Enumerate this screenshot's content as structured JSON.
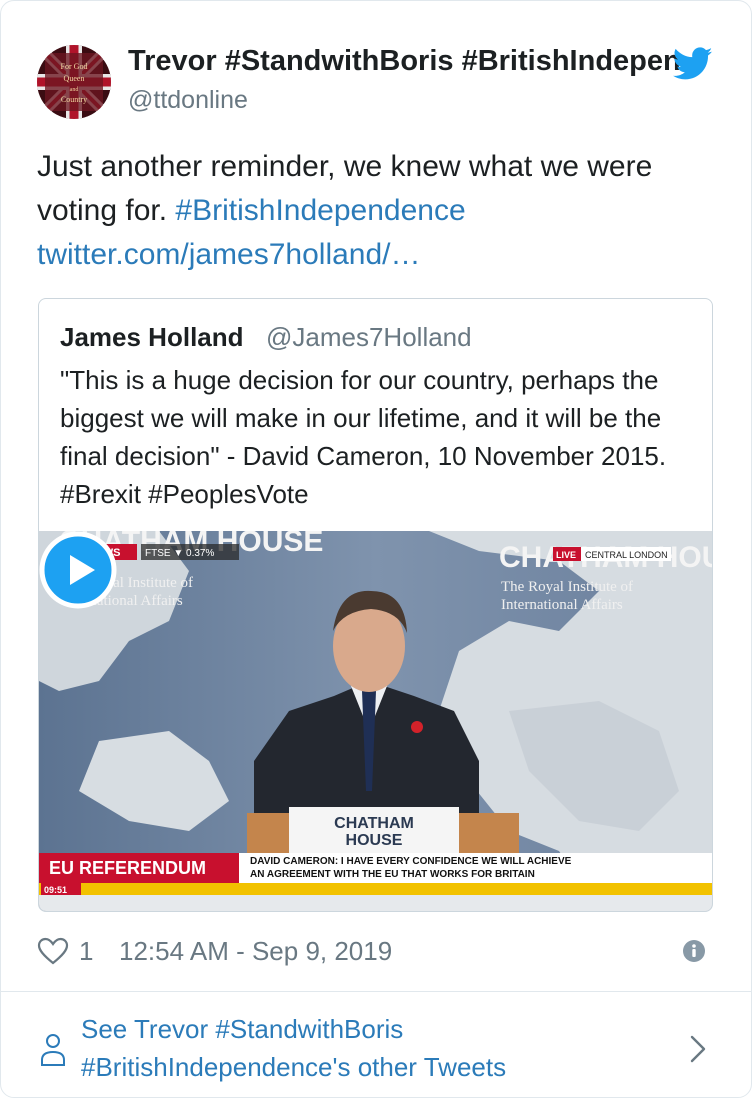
{
  "tweet": {
    "author_name": "Trevor #StandwithBoris #BritishIndependence",
    "author_handle": "@ttdonline",
    "text_plain": "Just another reminder, we knew what we were voting for. ",
    "hashtag": "#BritishIndependence",
    "link": "twitter.com/james7holland/…",
    "likes": "1",
    "timestamp": "12:54 AM - Sep 9, 2019"
  },
  "avatar": {
    "lines": [
      "For God",
      "Queen",
      "and",
      "Country"
    ]
  },
  "quoted": {
    "name": "James Holland",
    "handle": "@James7Holland",
    "text": "\"This is a huge decision for our country, perhaps the biggest we will make in our lifetime, and it will be the final decision\" - David Cameron, 10 November 2015. #Brexit #PeoplesVote"
  },
  "video": {
    "logo": "sky NEWS",
    "ticker": "FTSE ▼ 0.37%",
    "live": "LIVE",
    "location": "CENTRAL LONDON",
    "banner_left_top": "CHATHAM HOUSE",
    "banner_left_sub1": "The Royal Institute of",
    "banner_left_sub2": "International Affairs",
    "banner_right_top": "CHATHAM HOUSE",
    "banner_right_sub1": "The Royal Institute of",
    "banner_right_sub2": "International Affairs",
    "podium_line1": "CHATHAM",
    "podium_line2": "HOUSE",
    "strap": "EU REFERENDUM",
    "caption_line1": "DAVID CAMERON: I HAVE EVERY CONFIDENCE WE WILL ACHIEVE",
    "caption_line2": "AN AGREEMENT WITH THE EU THAT WORKS FOR BRITAIN",
    "clock": "09:51"
  },
  "footer": {
    "text": "See Trevor #StandwithBoris #BritishIndependence's other Tweets"
  },
  "icons": {
    "bird": "twitter-bird-icon",
    "heart": "heart-icon",
    "info": "info-icon",
    "person": "person-icon",
    "chevron": "chevron-right-icon",
    "play": "play-icon"
  },
  "colors": {
    "link": "#2b7bb9",
    "twitter_blue": "#1da1f2",
    "muted": "#697882",
    "sky_red": "#c8102e"
  }
}
